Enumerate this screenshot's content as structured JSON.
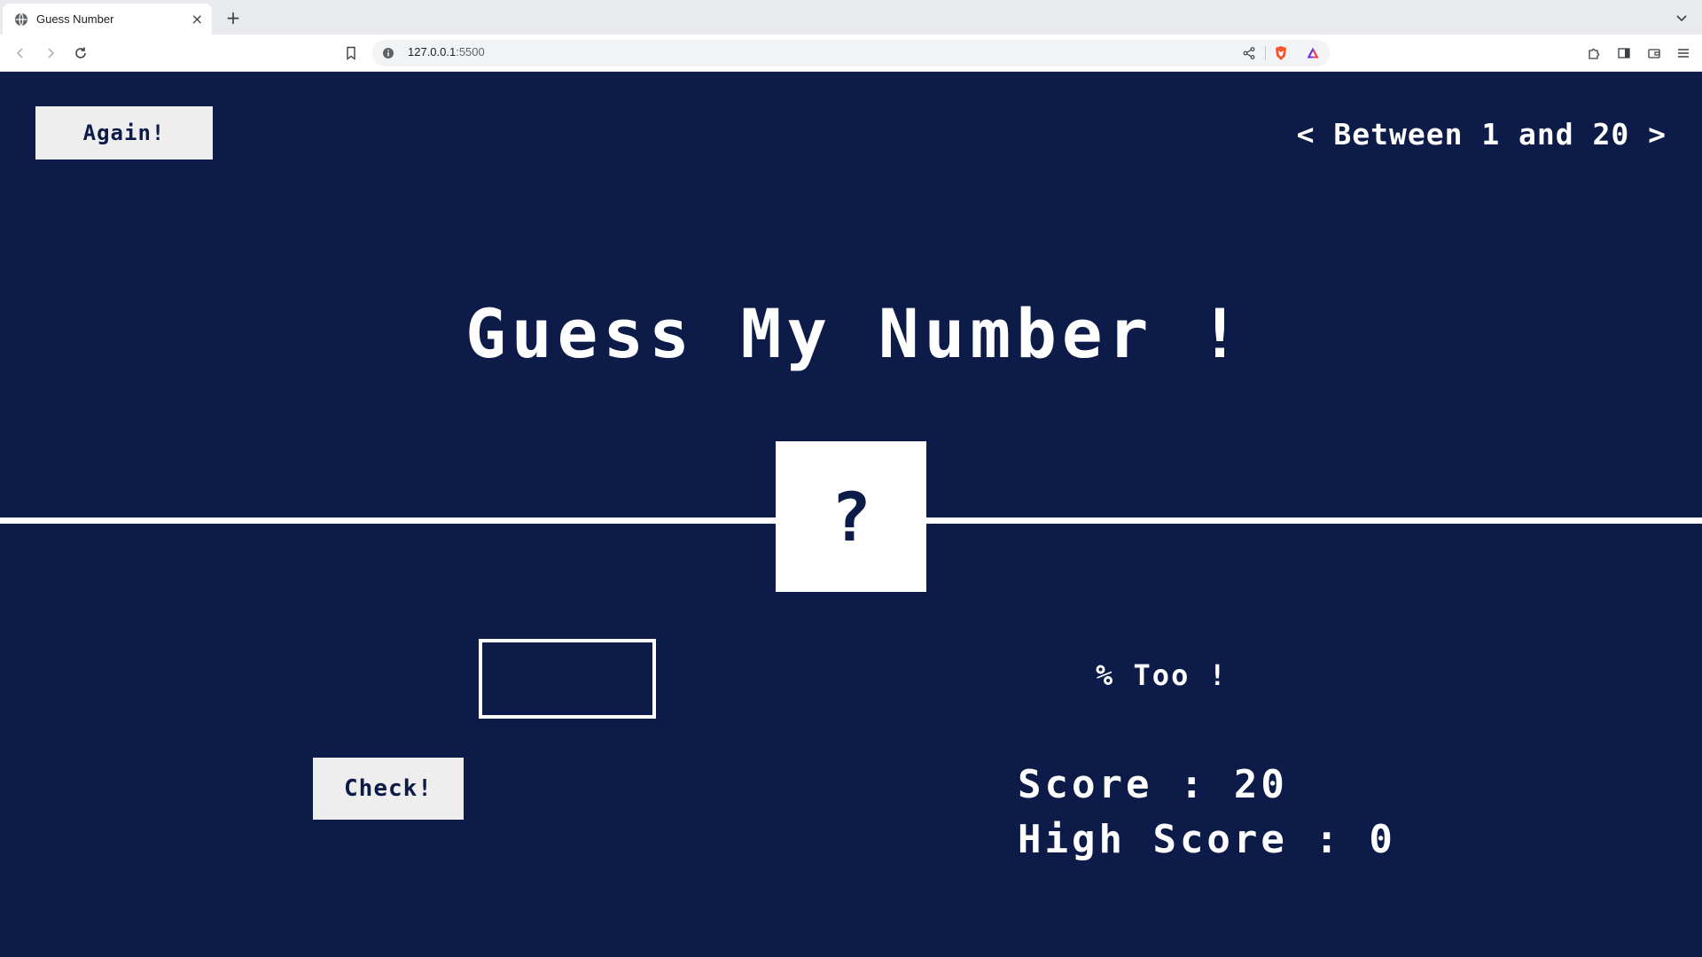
{
  "browser": {
    "tab_title": "Guess Number",
    "url_host": "127.0.0.1",
    "url_port": ":5500",
    "icons": {
      "favicon": "globe-icon",
      "tab_close": "close-icon",
      "new_tab": "plus-icon",
      "tab_menu": "chevron-down-icon",
      "back": "back-arrow-icon",
      "forward": "forward-arrow-icon",
      "reload": "reload-icon",
      "bookmark": "bookmark-icon",
      "site_info": "info-icon",
      "share": "share-icon",
      "shield": "brave-shield-icon",
      "rewards": "brave-rewards-icon",
      "extensions": "puzzle-icon",
      "sidebar": "sidebar-icon",
      "wallet": "wallet-icon",
      "menu": "hamburger-menu-icon"
    },
    "close_glyph": "×",
    "new_tab_glyph": "+"
  },
  "game": {
    "again_label": "Again!",
    "range_text": "< Between 1 and 20 >",
    "title": "Guess My Number !",
    "secret_display": "?",
    "guess_value": "",
    "check_label": "Check!",
    "message": "% Too !",
    "score_label": "Score : ",
    "score_value": "20",
    "highscore_label": "High Score : ",
    "highscore_value": "0"
  },
  "colors": {
    "background": "#0c1b47",
    "foreground": "#ffffff",
    "button_bg": "#eeeeee",
    "brave_orange": "#fb542b"
  }
}
